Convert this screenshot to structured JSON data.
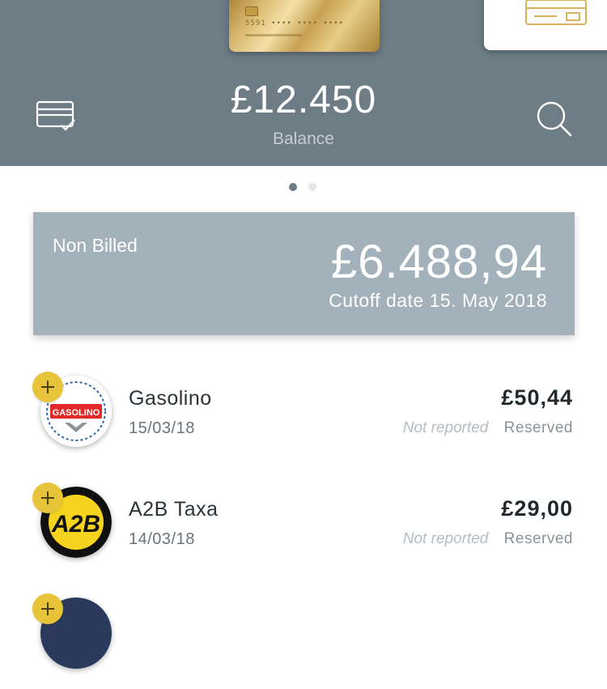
{
  "header": {
    "balance_amount": "£12.450",
    "balance_label": "Balance",
    "gold_card_number": "5591 •••• •••• ••••"
  },
  "carousel": {
    "pages": 2,
    "active_page": 1
  },
  "summary": {
    "label": "Non Billed",
    "amount": "£6.488,94",
    "cutoff": "Cutoff date 15. May 2018"
  },
  "transactions": [
    {
      "merchant": "Gasolino",
      "date": "15/03/18",
      "amount": "£50,44",
      "note": "Not reported",
      "status": "Reserved",
      "logo_text": "GASOLINO"
    },
    {
      "merchant": "A2B Taxa",
      "date": "14/03/18",
      "amount": "£29,00",
      "note": "Not reported",
      "status": "Reserved",
      "logo_text": "A2B"
    }
  ],
  "icons": {
    "cards": "cards-icon",
    "search": "search-icon",
    "add": "plus-icon"
  },
  "colors": {
    "header_bg": "#6d7c85",
    "summary_bg": "#a2b1ba",
    "badge_yellow": "#e8c43a"
  }
}
